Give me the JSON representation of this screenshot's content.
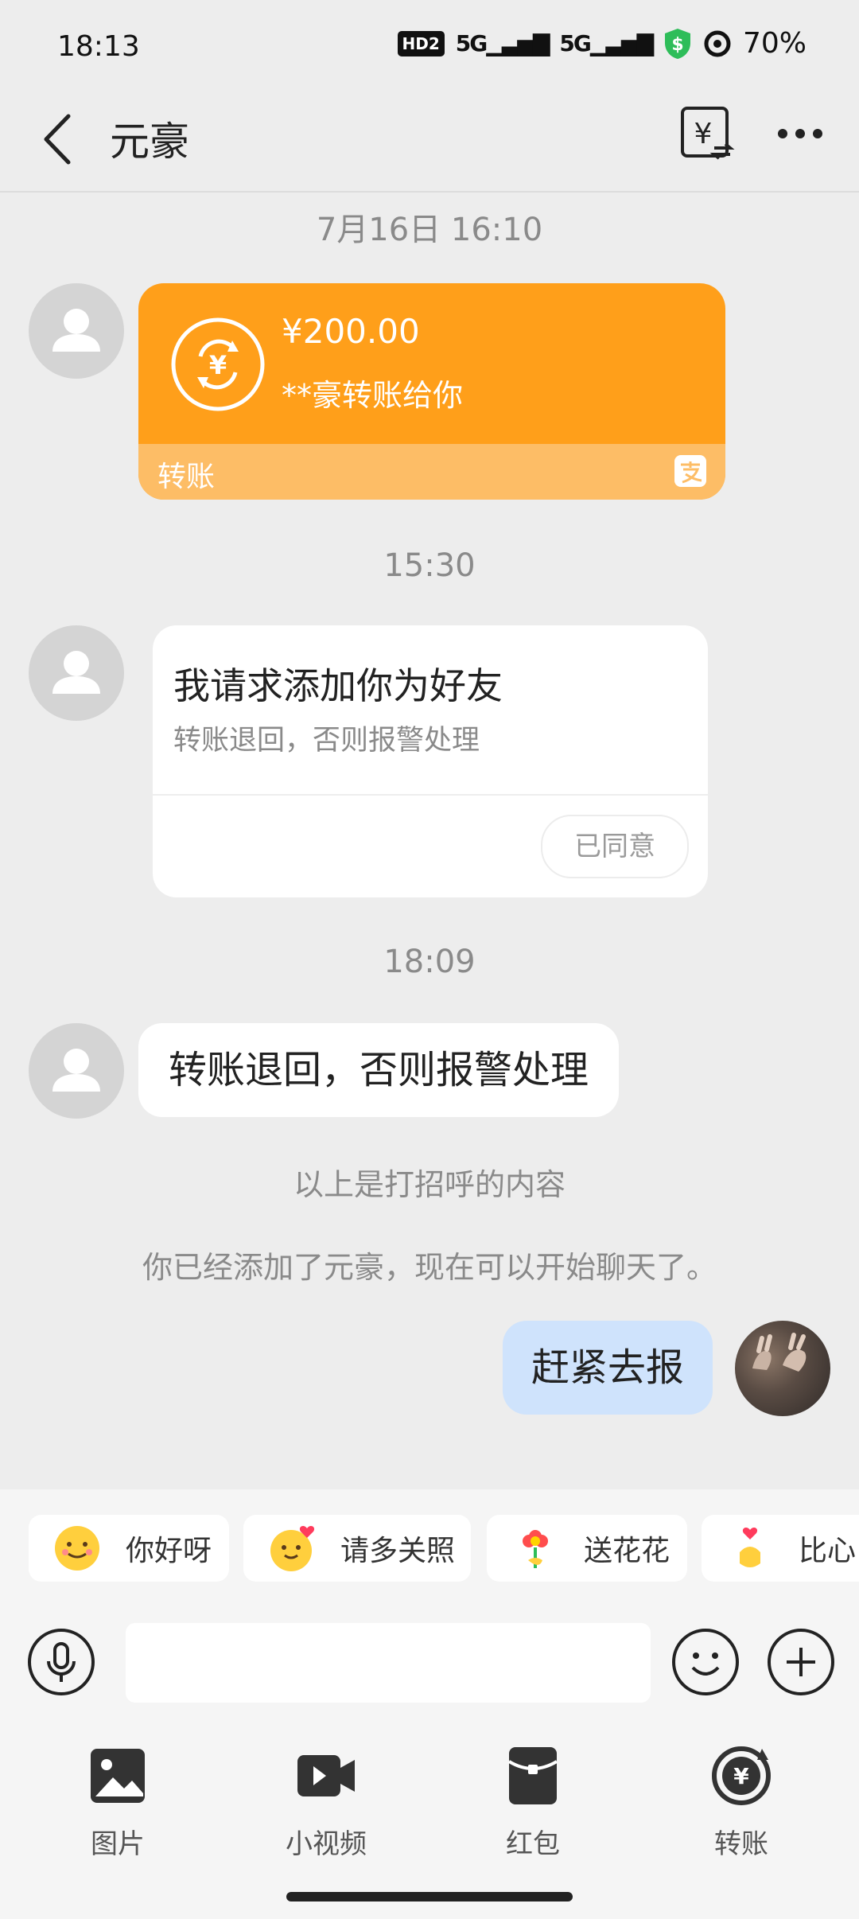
{
  "status_bar": {
    "time": "18:13",
    "hd": "HD2",
    "net1": "5G",
    "net2": "5G",
    "battery": "70%"
  },
  "header": {
    "title": "元豪"
  },
  "messages": {
    "stamp1": "7月16日 16:10",
    "transfer": {
      "amount": "¥200.00",
      "desc": "**豪转账给你",
      "label": "转账"
    },
    "stamp2": "15:30",
    "request": {
      "title": "我请求添加你为好友",
      "subtitle": "转账退回，否则报警处理",
      "button": "已同意"
    },
    "stamp3": "18:09",
    "incoming": "转账退回，否则报警处理",
    "sys1": "以上是打招呼的内容",
    "sys2": "你已经添加了元豪，现在可以开始聊天了。",
    "outgoing": "赶紧去报"
  },
  "quick_replies": [
    {
      "label": "你好呀",
      "icon": "smiling-face-icon"
    },
    {
      "label": "请多关照",
      "icon": "hug-face-icon"
    },
    {
      "label": "送花花",
      "icon": "flower-icon"
    },
    {
      "label": "比心",
      "icon": "finger-heart-icon"
    }
  ],
  "input": {
    "placeholder": ""
  },
  "tools": [
    {
      "label": "图片",
      "icon": "image-icon"
    },
    {
      "label": "小视频",
      "icon": "video-icon"
    },
    {
      "label": "红包",
      "icon": "red-packet-icon"
    },
    {
      "label": "转账",
      "icon": "transfer-icon"
    }
  ],
  "colors": {
    "transfer_orange": "#ff9f1a",
    "transfer_strip": "#fdbd66",
    "outgoing_bubble": "#cfe3fc",
    "background": "#ededed"
  }
}
